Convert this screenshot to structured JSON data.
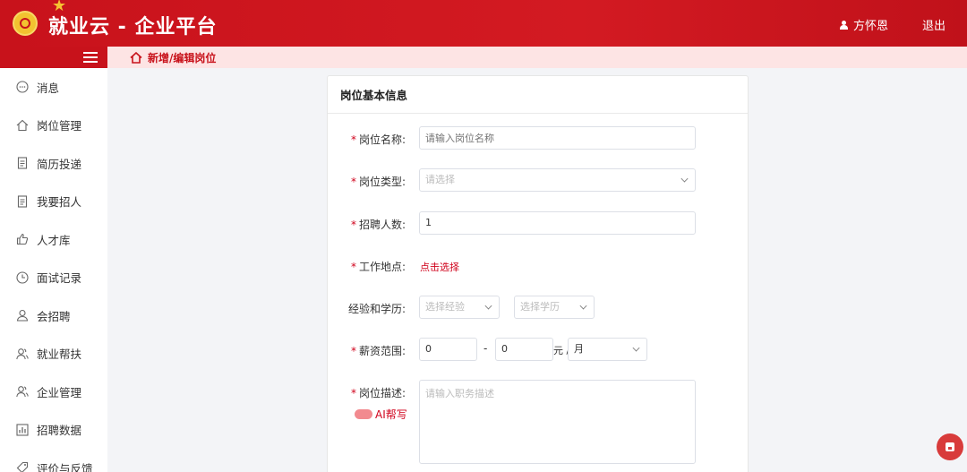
{
  "header": {
    "title": "就业云 - 企业平台",
    "user_name": "方怀恩",
    "logout_label": "退出"
  },
  "breadcrumb": {
    "current": "新增/编辑岗位"
  },
  "sidebar": {
    "items": [
      {
        "label": "消息",
        "icon": "message-icon"
      },
      {
        "label": "岗位管理",
        "icon": "home-icon"
      },
      {
        "label": "简历投递",
        "icon": "document-icon"
      },
      {
        "label": "我要招人",
        "icon": "document-icon"
      },
      {
        "label": "人才库",
        "icon": "thumbs-up-icon"
      },
      {
        "label": "面试记录",
        "icon": "clock-icon"
      },
      {
        "label": "会招聘",
        "icon": "user-icon"
      },
      {
        "label": "就业帮扶",
        "icon": "users-icon"
      },
      {
        "label": "企业管理",
        "icon": "users-icon"
      },
      {
        "label": "招聘数据",
        "icon": "chart-icon"
      },
      {
        "label": "评价与反馈",
        "icon": "tag-icon"
      }
    ]
  },
  "form": {
    "section_title": "岗位基本信息",
    "job_name": {
      "label": "岗位名称:",
      "placeholder": "请输入岗位名称"
    },
    "job_type": {
      "label": "岗位类型:",
      "placeholder": "请选择"
    },
    "headcount": {
      "label": "招聘人数:",
      "value": "1"
    },
    "location": {
      "label": "工作地点:",
      "link": "点击选择"
    },
    "experience": {
      "label": "经验和学历:",
      "exp_placeholder": "选择经验",
      "edu_placeholder": "选择学历"
    },
    "salary": {
      "label": "薪资范围:",
      "min": "0",
      "max": "0",
      "dash": "-",
      "unit": "元 /",
      "period": "月"
    },
    "description": {
      "label": "岗位描述:",
      "placeholder": "请输入职务描述",
      "ai_label": "AI帮写"
    }
  },
  "colors": {
    "brand": "#c8121b",
    "accent": "#d0021b"
  }
}
